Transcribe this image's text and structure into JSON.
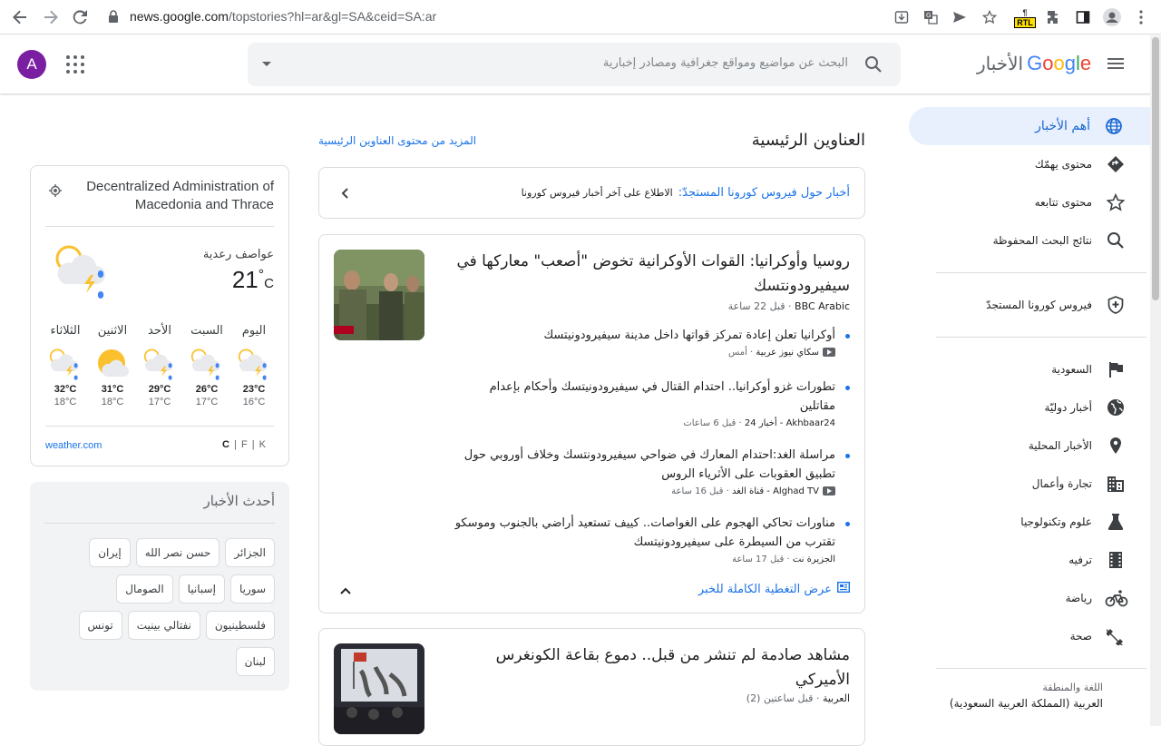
{
  "browser": {
    "url_host": "news.google.com",
    "url_path": "/topstories?hl=ar&gl=SA&ceid=SA:ar",
    "rtl_badge": "RTL"
  },
  "header": {
    "avatar_letter": "A",
    "search_placeholder": "البحث عن مواضيع ومواقع جغرافية ومصادر إخبارية",
    "logo_letters": [
      "G",
      "o",
      "o",
      "g",
      "l",
      "e"
    ],
    "logo_suffix": "الأخبار"
  },
  "sidebar": {
    "items": [
      {
        "label": "أهم الأخبار",
        "icon": "globe-icon",
        "active": true
      },
      {
        "label": "محتوى يهمّك",
        "icon": "diamond-icon"
      },
      {
        "label": "محتوى تتابعه",
        "icon": "star-icon"
      },
      {
        "label": "نتائج البحث المحفوظة",
        "icon": "search-icon"
      }
    ],
    "covid": {
      "label": "فيروس كورونا المستجدّ",
      "icon": "shield-icon"
    },
    "sections": [
      {
        "label": "السعودية",
        "icon": "flag-icon"
      },
      {
        "label": "أخبار دوليّة",
        "icon": "world-icon"
      },
      {
        "label": "الأخبار المحلية",
        "icon": "location-pin-icon"
      },
      {
        "label": "تجارة وأعمال",
        "icon": "building-icon"
      },
      {
        "label": "علوم وتكنولوجيا",
        "icon": "flask-icon"
      },
      {
        "label": "ترفيه",
        "icon": "film-icon"
      },
      {
        "label": "رياضة",
        "icon": "bike-icon"
      },
      {
        "label": "صحة",
        "icon": "dumbbell-icon"
      }
    ],
    "language_label": "اللغة والمنطقة",
    "language_value": "العربية (المملكة العربية السعودية)"
  },
  "main": {
    "title": "العناوين الرئيسية",
    "more_link": "المزيد من محتوى العناوين الرئيسية",
    "covid_banner": {
      "link": "أخبار حول فيروس كورونا المستجدّ:",
      "text": "الاطلاع على آخر أخبار فيروس كورونا"
    },
    "story1": {
      "headline": "روسيا وأوكرانيا: القوات الأوكرانية تخوض \"أصعب\" معاركها في سيفيرودونتسك",
      "source": "BBC Arabic",
      "time": "قبل 22 ساعة",
      "subs": [
        {
          "headline": "أوكرانيا تعلن إعادة تمركز قواتها داخل مدينة سيفيرودونيتسك",
          "source": "سكاي نيوز عربية",
          "time": "أمس",
          "video": true
        },
        {
          "headline": "تطورات غزو أوكرانيا.. احتدام القتال في سيفيرودونيتسك وأحكام بإعدام مقاتلين",
          "source": "Akhbaar24 - أخبار 24",
          "time": "قبل 6 ساعات",
          "video": false
        },
        {
          "headline": "مراسلة الغد:احتدام المعارك في ضواحي سيفيرودونتسك وخلاف أوروبي حول تطبيق العقوبات على الأثرياء الروس",
          "source": "Alghad TV - قناة الغد",
          "time": "قبل 16 ساعة",
          "video": true
        },
        {
          "headline": "مناورات تحاكي الهجوم على الغواصات.. كييف تستعيد أراضي بالجنوب وموسكو تقترب من السيطرة على سيفيرودونيتسك",
          "source": "الجزيرة نت",
          "time": "قبل 17 ساعة",
          "video": false
        }
      ],
      "full_coverage": "عرض التغطية الكاملة للخبر"
    },
    "story2": {
      "headline": "مشاهد صادمة لم تنشر من قبل.. دموع بقاعة الكونغرس الأميركي",
      "source": "العربية",
      "time": "قبل ساعتين (2)"
    }
  },
  "weather": {
    "location": "Decentralized Administration of Macedonia and Thrace",
    "condition": "عواصف رعدية",
    "temp": "21",
    "unit": "C",
    "forecast": [
      {
        "day": "اليوم",
        "hi": "23°C",
        "lo": "16°C",
        "icon": "storm-icon"
      },
      {
        "day": "السبت",
        "hi": "26°C",
        "lo": "17°C",
        "icon": "storm-icon"
      },
      {
        "day": "الأحد",
        "hi": "29°C",
        "lo": "17°C",
        "icon": "storm-icon"
      },
      {
        "day": "الاثنين",
        "hi": "31°C",
        "lo": "18°C",
        "icon": "partly-sunny-icon"
      },
      {
        "day": "الثلاثاء",
        "hi": "32°C",
        "lo": "18°C",
        "icon": "storm-icon"
      }
    ],
    "source": "weather.com",
    "units": [
      "C",
      "F",
      "K"
    ]
  },
  "latest": {
    "title": "أحدث الأخبار",
    "chips": [
      "الجزائر",
      "حسن نصر الله",
      "إيران",
      "سوريا",
      "إسبانيا",
      "الصومال",
      "فلسطينيون",
      "نفتالي بينيت",
      "تونس",
      "لبنان"
    ]
  }
}
